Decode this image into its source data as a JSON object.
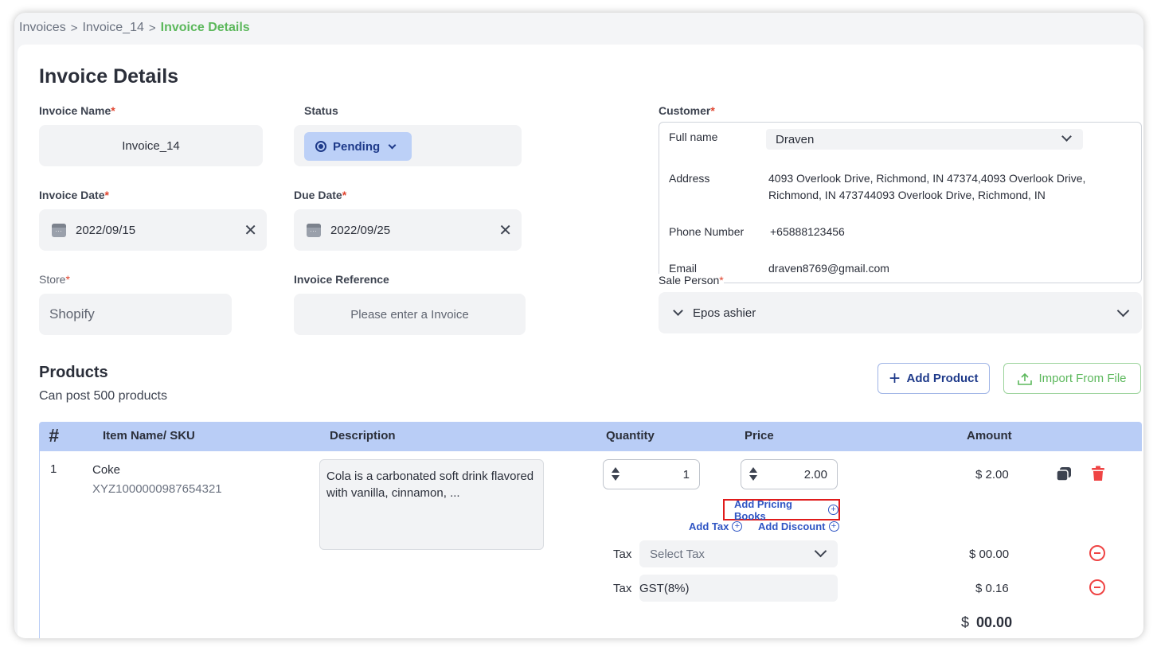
{
  "breadcrumb": [
    "Invoices",
    "Invoice_14",
    "Invoice Details"
  ],
  "page_title": "Invoice Details",
  "form": {
    "invoice_name": {
      "label": "Invoice Name",
      "value": "Invoice_14"
    },
    "status": {
      "label": "Status",
      "value": "Pending"
    },
    "invoice_date": {
      "label": "Invoice Date",
      "value": "2022/09/15"
    },
    "due_date": {
      "label": "Due Date",
      "value": "2022/09/25"
    },
    "store": {
      "label": "Store",
      "value": "Shopify"
    },
    "invoice_reference": {
      "label": "Invoice Reference",
      "placeholder": "Please enter a Invoice"
    }
  },
  "customer": {
    "label": "Customer",
    "full_name_label": "Full name",
    "full_name": "Draven",
    "address_label": "Address",
    "address_line1": "4093 Overlook Drive, Richmond, IN 47374,4093 Overlook Drive,",
    "address_line2": "Richmond, IN 473744093 Overlook Drive, Richmond, IN",
    "phone_label": "Phone Number",
    "phone": "+65888123456",
    "email_label": "Email",
    "email": "draven8769@gmail.com"
  },
  "sale_person": {
    "label": "Sale Person",
    "value": "Epos ashier"
  },
  "products": {
    "title": "Products",
    "subtitle": "Can post 500 products",
    "add_product_label": "Add Product",
    "import_label": "Import From File",
    "columns": [
      "#",
      "Item Name/ SKU",
      "Description",
      "Quantity",
      "Price",
      "Amount"
    ],
    "rows": [
      {
        "index": "1",
        "name": "Coke",
        "sku": "XYZ1000000987654321",
        "description": "Cola is a carbonated soft drink flavored with vanilla, cinnamon, ...",
        "quantity": "1",
        "price": "2.00",
        "amount": "$ 2.00"
      }
    ],
    "add_pricing_books": "Add Pricing Books",
    "add_tax": "Add Tax",
    "add_discount": "Add Discount",
    "tax_rows": [
      {
        "label": "Tax",
        "value": "Select Tax",
        "amount": "$ 00.00"
      },
      {
        "label": "Tax",
        "value": "GST(8%)",
        "amount": "$ 0.16"
      }
    ],
    "total_currency": "$",
    "total_value": "00.00"
  },
  "colors": {
    "accent_green": "#5cb85c",
    "primary_blue": "#2f55c4",
    "danger_red": "#ef4444",
    "highlight_box": "#e01b1b"
  }
}
